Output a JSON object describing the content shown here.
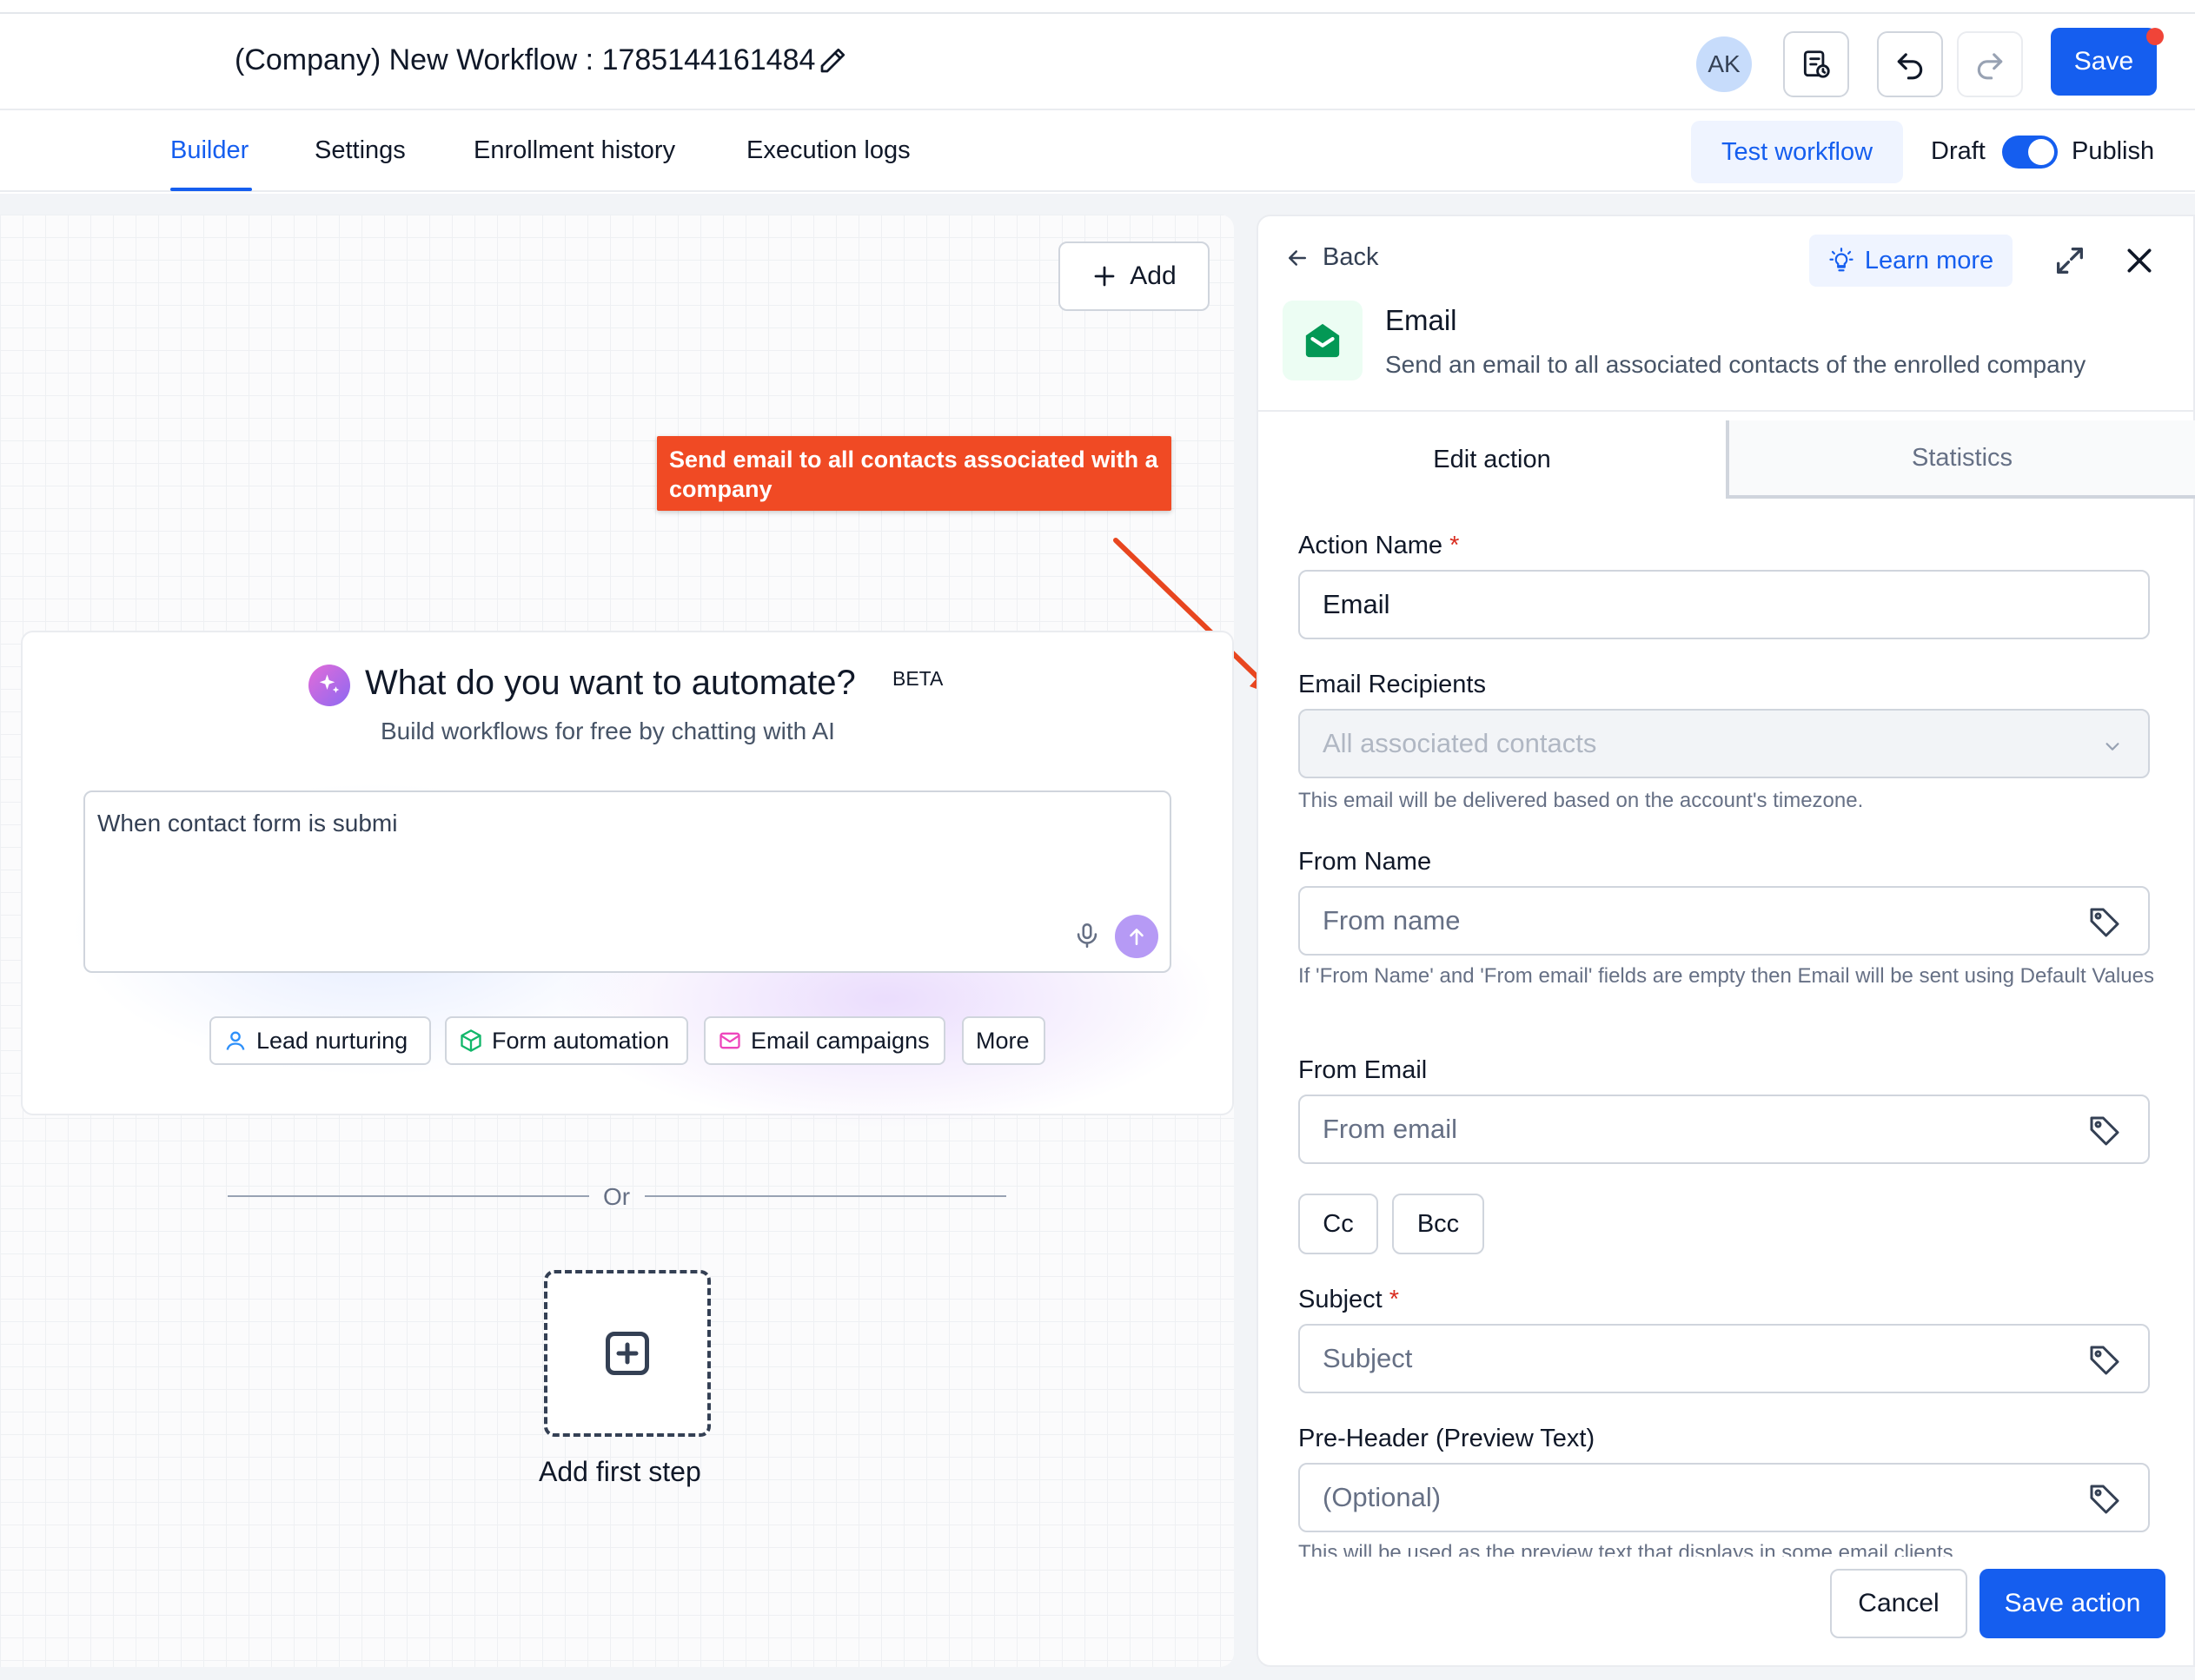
{
  "header": {
    "workflow_title": "(Company) New Workflow : 1785144161484",
    "avatar_initials": "AK",
    "save_label": "Save"
  },
  "nav": {
    "tabs": [
      {
        "label": "Builder",
        "active": true
      },
      {
        "label": "Settings"
      },
      {
        "label": "Enrollment history"
      },
      {
        "label": "Execution logs"
      }
    ],
    "test_workflow_label": "Test workflow",
    "draft_label": "Draft",
    "publish_label": "Publish",
    "publish_toggle_on": true
  },
  "canvas": {
    "add_label": "Add",
    "callout": "Send email to all contacts associated with a company",
    "ai": {
      "title": "What do you want to automate?",
      "badge": "BETA",
      "subtitle": "Build workflows for free by chatting with AI",
      "input_value": "When contact form is submi",
      "chips": [
        "Lead nurturing",
        "Form automation",
        "Email campaigns",
        "More"
      ]
    },
    "or_label": "Or",
    "first_step_label": "Add first step"
  },
  "panel": {
    "back_label": "Back",
    "learn_more_label": "Learn more",
    "action_title": "Email",
    "action_description": "Send an email to all associated contacts of the enrolled company",
    "tabs": {
      "edit": "Edit action",
      "stats": "Statistics"
    },
    "fields": {
      "action_name": {
        "label": "Action Name",
        "required": "*",
        "value": "Email"
      },
      "recipients": {
        "label": "Email Recipients",
        "value": "All associated contacts",
        "hint": "This email will be delivered based on the account's timezone."
      },
      "from_name": {
        "label": "From Name",
        "placeholder": "From name",
        "hint": "If 'From Name' and 'From email' fields are empty then Email will be sent using Default Values"
      },
      "from_email": {
        "label": "From Email",
        "placeholder": "From email"
      },
      "cc_label": "Cc",
      "bcc_label": "Bcc",
      "subject": {
        "label": "Subject",
        "required": "*",
        "placeholder": "Subject"
      },
      "preheader": {
        "label": "Pre-Header (Preview Text)",
        "placeholder": "(Optional)",
        "hint": "This will be used as the preview text that displays in some email clients"
      }
    },
    "cancel_label": "Cancel",
    "save_action_label": "Save action"
  },
  "colors": {
    "primary": "#155eef",
    "callout": "#f04a24",
    "email_icon": "#039855"
  },
  "icons": [
    "edit-icon",
    "history-icon",
    "undo-icon",
    "redo-icon",
    "plus-icon",
    "sparkle-icon",
    "mic-icon",
    "send-icon",
    "user-icon",
    "cube-icon",
    "mail-icon",
    "add-square-icon",
    "back-arrow-icon",
    "lightbulb-icon",
    "expand-icon",
    "close-icon",
    "email-open-icon",
    "chevron-down-icon",
    "tag-icon"
  ]
}
